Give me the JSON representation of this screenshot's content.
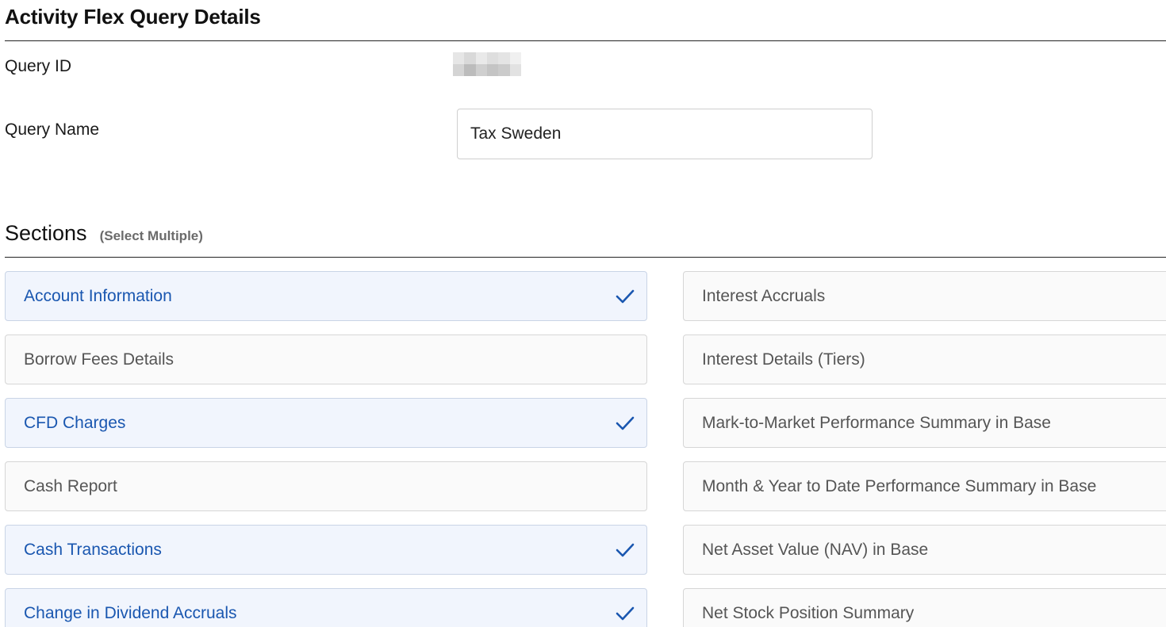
{
  "page": {
    "title": "Activity Flex Query Details"
  },
  "fields": {
    "query_id_label": "Query ID",
    "query_name_label": "Query Name",
    "query_name_value": "Tax Sweden"
  },
  "sections": {
    "title": "Sections",
    "subtitle": "(Select Multiple)",
    "left": [
      {
        "label": "Account Information",
        "selected": true
      },
      {
        "label": "Borrow Fees Details",
        "selected": false
      },
      {
        "label": "CFD Charges",
        "selected": true
      },
      {
        "label": "Cash Report",
        "selected": false
      },
      {
        "label": "Cash Transactions",
        "selected": true
      },
      {
        "label": "Change in Dividend Accruals",
        "selected": true
      }
    ],
    "right": [
      {
        "label": "Interest Accruals",
        "selected": false
      },
      {
        "label": "Interest Details (Tiers)",
        "selected": false
      },
      {
        "label": "Mark-to-Market Performance Summary in Base",
        "selected": false
      },
      {
        "label": "Month & Year to Date Performance Summary in Base",
        "selected": false
      },
      {
        "label": "Net Asset Value (NAV) in Base",
        "selected": false
      },
      {
        "label": "Net Stock Position Summary",
        "selected": false
      }
    ]
  },
  "icons": {
    "check": "checkmark-icon"
  },
  "colors": {
    "selected_text": "#1a57b0",
    "selected_bg": "#f1f5fd",
    "unselected_text": "#555555",
    "unselected_bg": "#fafafa",
    "check": "#1a57b0"
  }
}
